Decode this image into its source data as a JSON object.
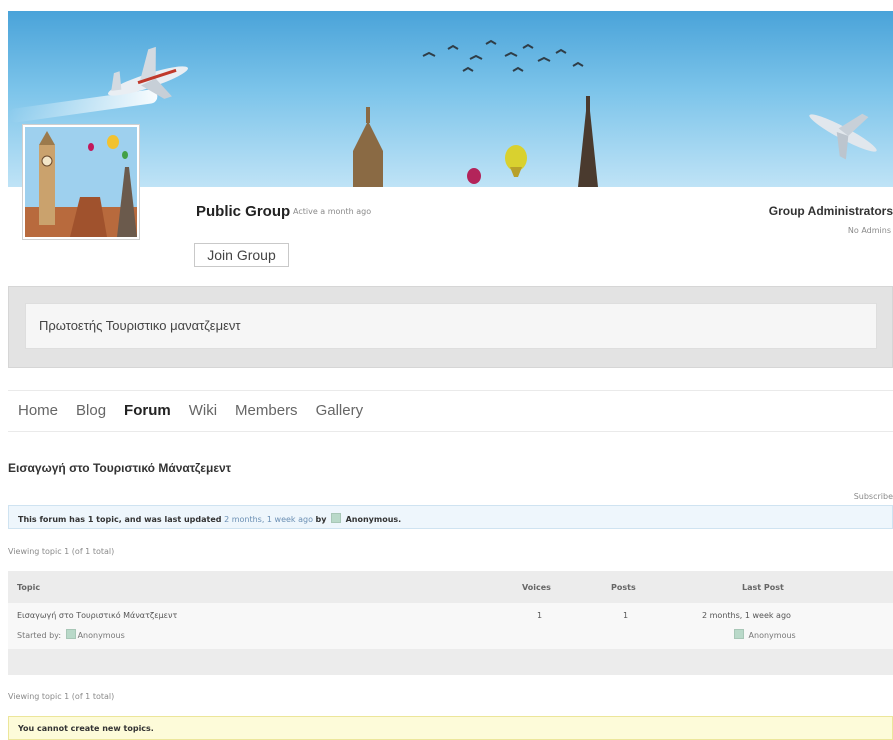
{
  "group": {
    "type": "Public Group",
    "activity": "Active a month ago",
    "join_label": "Join Group",
    "description": "Πρωτοετής Τουριστικο μανατζεμεντ"
  },
  "admins": {
    "title": "Group Administrators",
    "empty": "No Admins"
  },
  "nav": {
    "items": [
      "Home",
      "Blog",
      "Forum",
      "Wiki",
      "Members",
      "Gallery"
    ],
    "active": "Forum"
  },
  "forum": {
    "title": "Εισαγωγή στο Τουριστικό Μάνατζεμεντ",
    "subscribe": "Subscribe",
    "info_prefix": "This forum has 1 topic, and was last updated",
    "info_time": "2 months, 1 week ago",
    "info_by": "by",
    "info_author": "Anonymous.",
    "viewing_top": "Viewing topic 1 (of 1 total)",
    "viewing_bottom": "Viewing topic 1 (of 1 total)",
    "columns": {
      "topic": "Topic",
      "voices": "Voices",
      "posts": "Posts",
      "last_post": "Last Post"
    },
    "topics": [
      {
        "title": "Εισαγωγή στο Τουριστικό Μάνατζεμεντ",
        "started_label": "Started by:",
        "author": "Anonymous",
        "voices": "1",
        "posts": "1",
        "last_time": "2 months, 1 week ago",
        "last_author": "Anonymous"
      }
    ],
    "notice": "You cannot create new topics."
  },
  "colors": {
    "sky": "#7cc4ea",
    "info_bg": "#eef6fc",
    "notice_bg": "#fdfbd9",
    "link": "#6b8fb3"
  }
}
